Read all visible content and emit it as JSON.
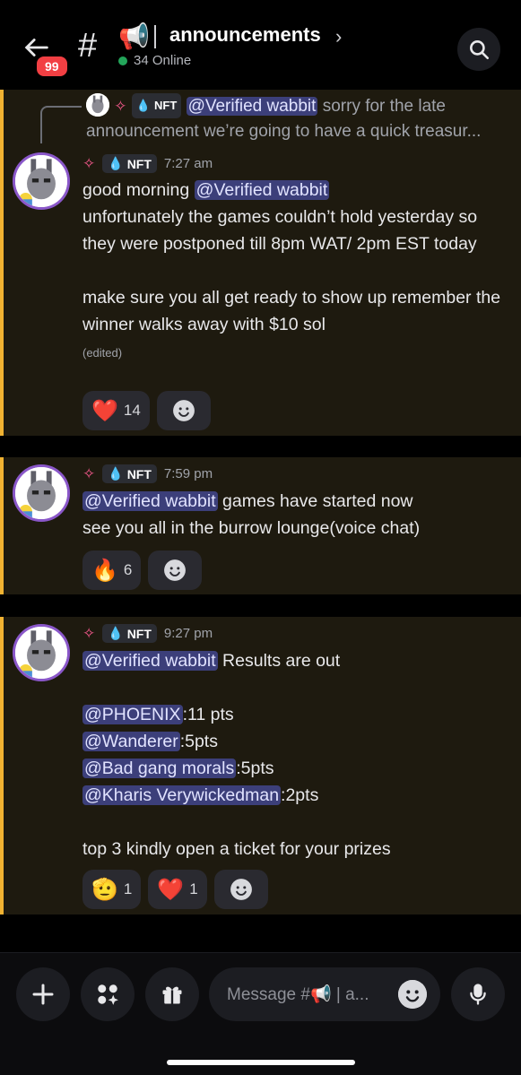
{
  "header": {
    "badge_count": "99",
    "channel_icon": "megaphone-icon",
    "channel_emoji": "📢",
    "channel_name": "announcements",
    "online": "34 Online"
  },
  "reply": {
    "tag": "NFT",
    "mention": "@Verified wabbit",
    "text": " sorry for the late announcement  we’re going to have a quick treasur..."
  },
  "messages": [
    {
      "tag": "NFT",
      "time": "7:27 am",
      "line1_pre": "good morning ",
      "line1_mention": "@Verified wabbit",
      "rest": "unfortunately the games couldn’t hold yesterday so they were postponed till 8pm WAT/ 2pm EST today\n\nmake sure you all get ready to show up remember the winner walks away with $10 sol",
      "edited": "(edited)",
      "reactions": [
        {
          "emoji": "❤️",
          "count": "14"
        }
      ]
    },
    {
      "tag": "NFT",
      "time": "7:59 pm",
      "mention": "@Verified wabbit",
      "text": " games have started now\nsee you all in the burrow lounge(voice chat)",
      "reactions": [
        {
          "emoji": "🔥",
          "count": "6"
        }
      ]
    },
    {
      "tag": "NFT",
      "time": "9:27 pm",
      "mention": "@Verified wabbit",
      "text": " Results are out",
      "results": [
        {
          "mention": "@PHOENIX",
          "score": ":11 pts"
        },
        {
          "mention": "@Wanderer",
          "score": ":5pts"
        },
        {
          "mention": "@Bad gang morals",
          "score": ":5pts"
        },
        {
          "mention": "@Kharis Verywickedman",
          "score": ":2pts"
        }
      ],
      "footer": "top 3 kindly open a ticket for your prizes",
      "reactions": [
        {
          "emoji": "🫡",
          "count": "1"
        },
        {
          "emoji": "❤️",
          "count": "1"
        }
      ]
    }
  ],
  "composer": {
    "placeholder": "Message #📢 | a..."
  },
  "colors": {
    "accent_bar": "#f0b232",
    "mention_bg": "#3c3f7a",
    "badge": "#f23f43",
    "online": "#23a55a"
  }
}
